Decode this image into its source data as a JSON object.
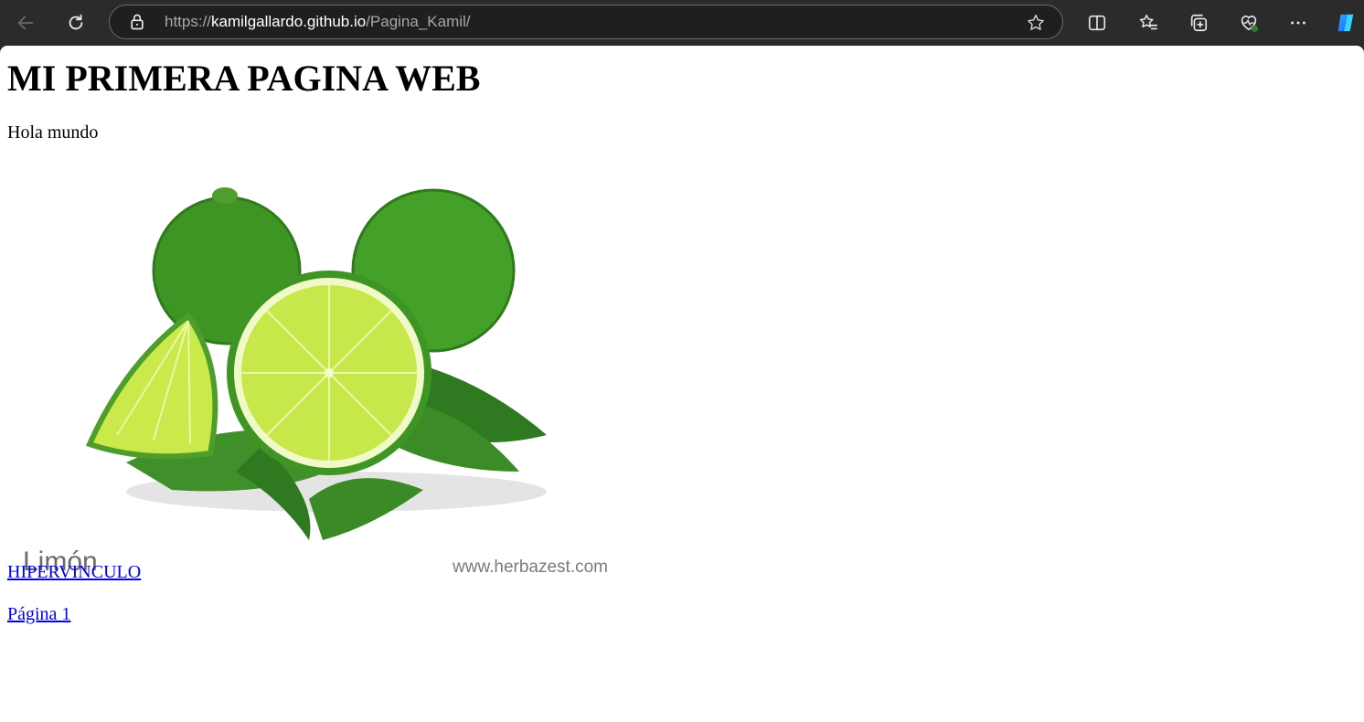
{
  "browser": {
    "url_scheme": "https://",
    "url_host": "kamilgallardo.github.io",
    "url_path": "/Pagina_Kamil/",
    "toolbar_icons": [
      "back-icon",
      "refresh-icon",
      "lock-icon",
      "favorite-star-icon",
      "split-screen-icon",
      "favorites-icon",
      "collections-icon",
      "browser-essentials-icon",
      "more-icon",
      "copilot-icon"
    ],
    "accent_color": "#2e7d32"
  },
  "page": {
    "heading": "MI PRIMERA PAGINA WEB",
    "paragraph": "Hola mundo",
    "image": {
      "caption": "Limón",
      "credit": "www.herbazest.com"
    },
    "links": [
      {
        "label": "HIPERVINCULO"
      },
      {
        "label": "Página 1"
      }
    ]
  }
}
